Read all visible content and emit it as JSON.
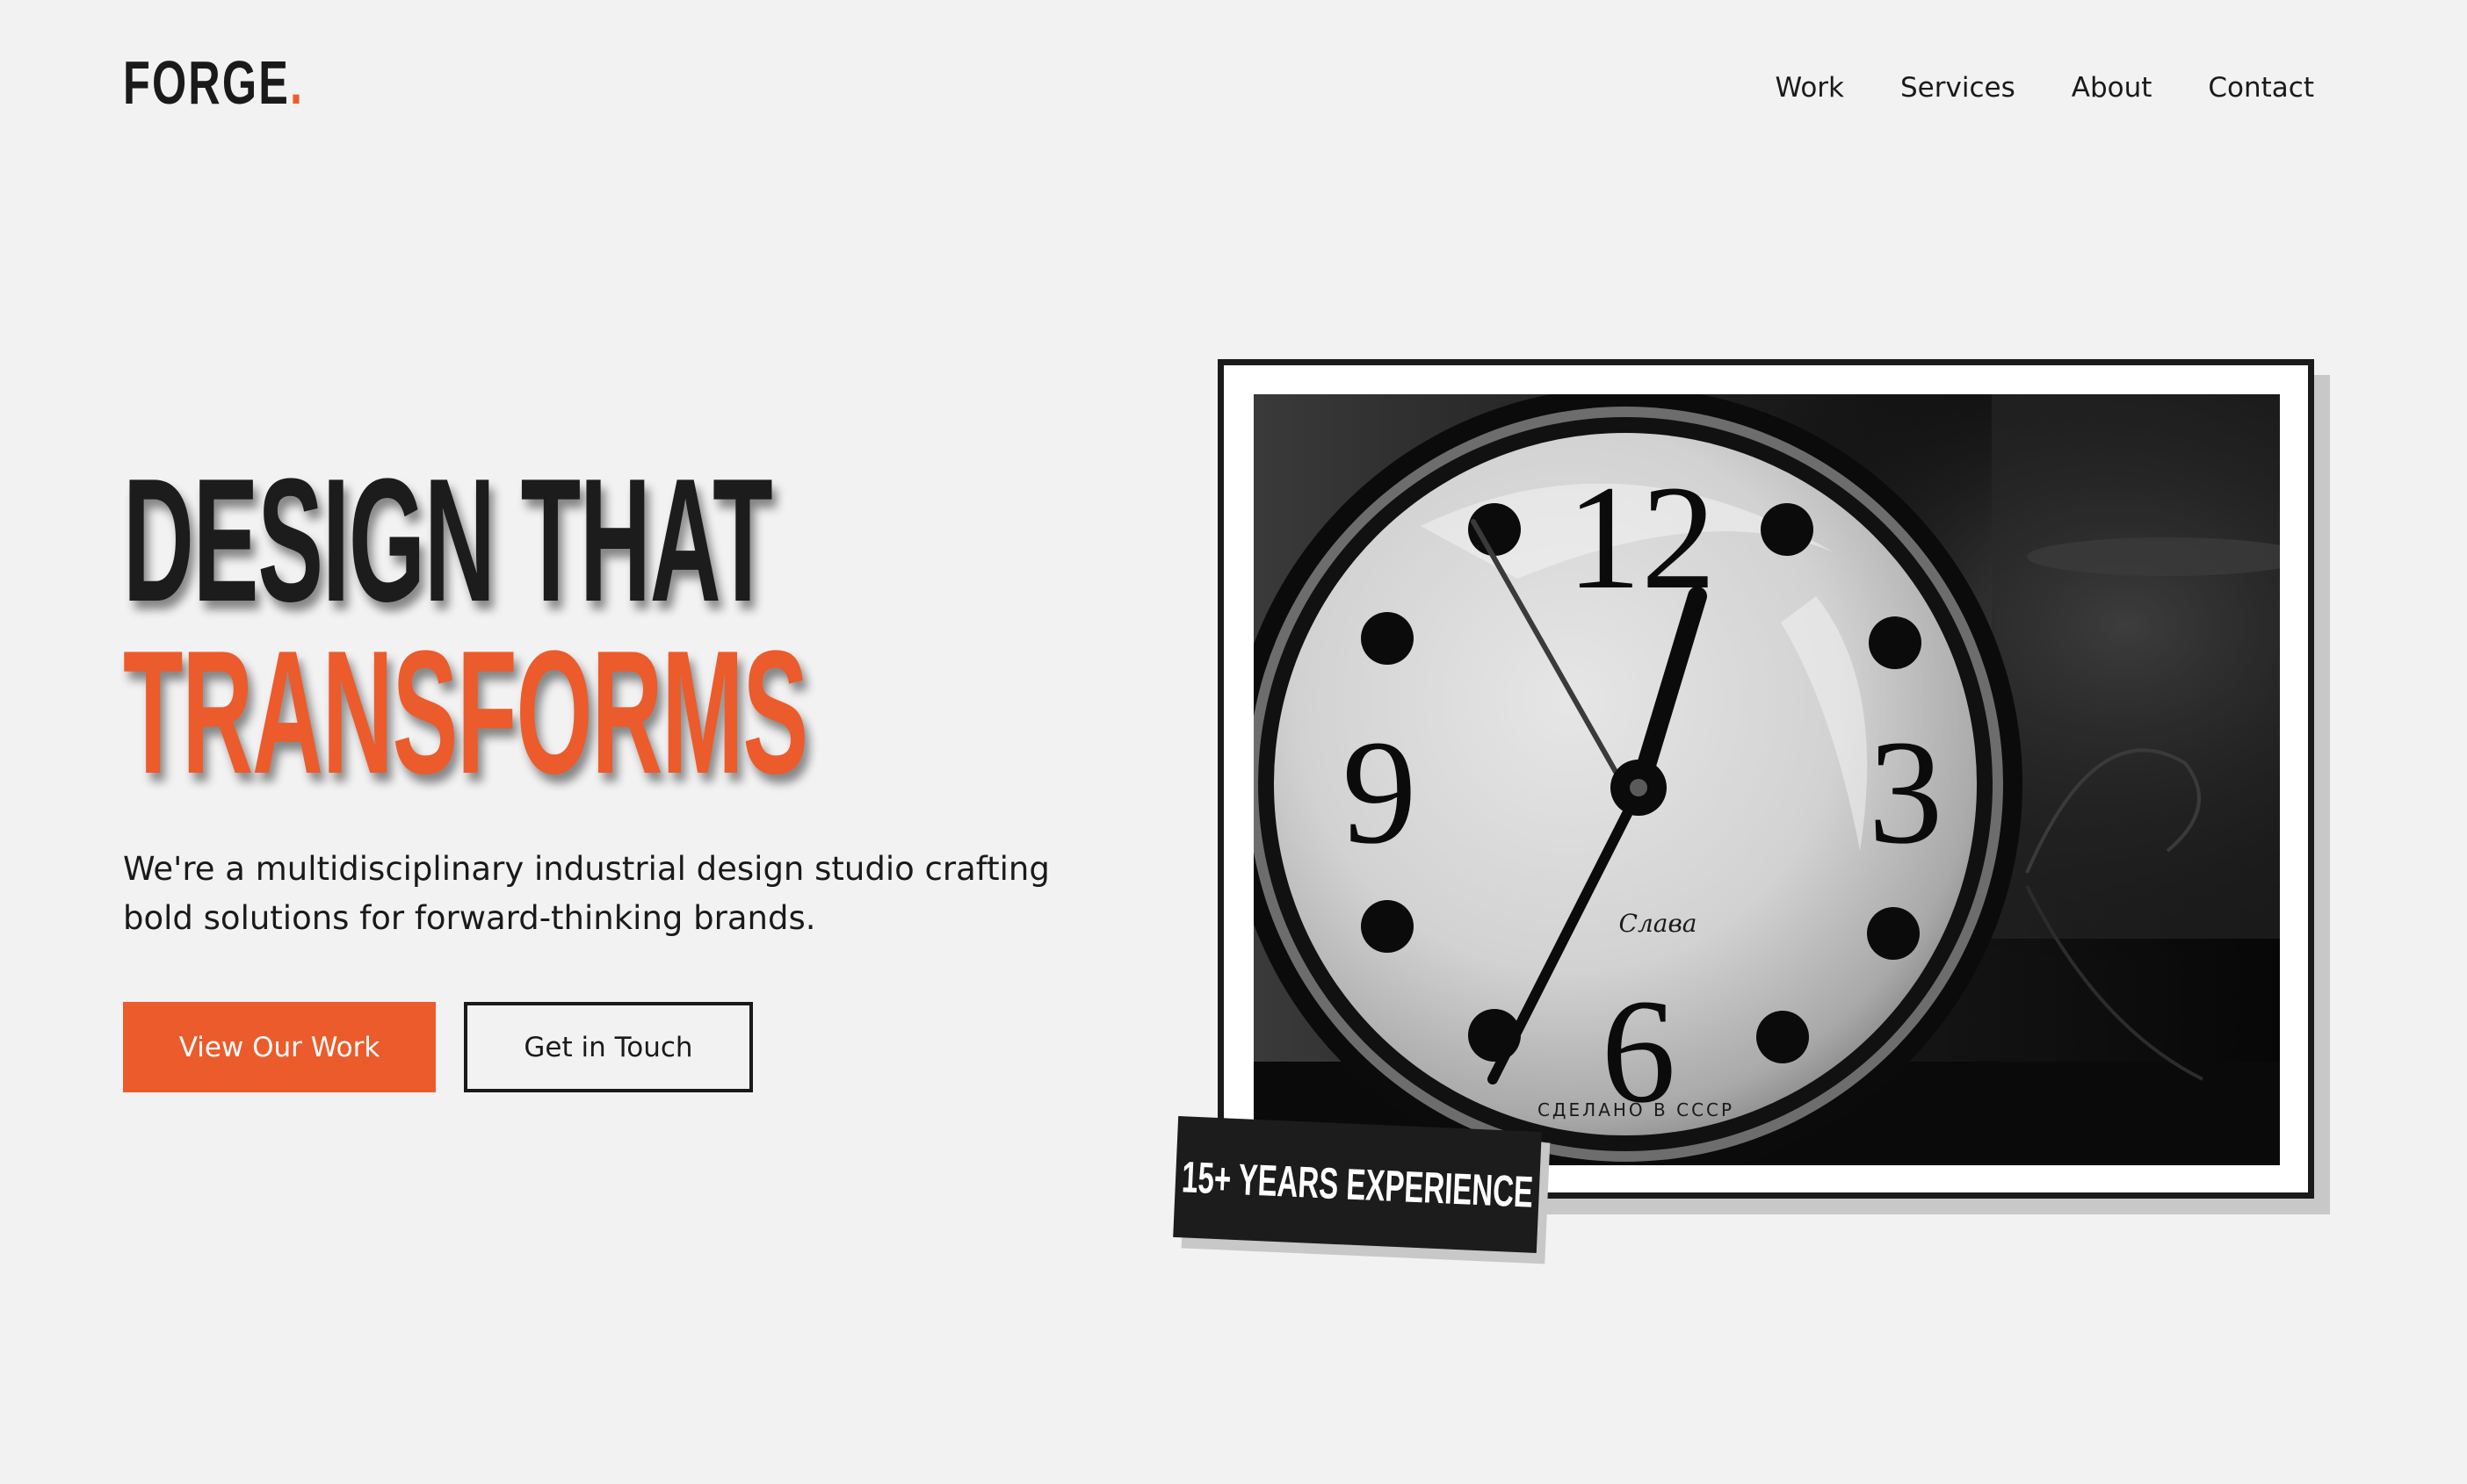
{
  "brand": {
    "name": "FORGE",
    "dot": ".",
    "accent_color": "#ec5b2b"
  },
  "nav": {
    "items": [
      {
        "label": "Work"
      },
      {
        "label": "Services"
      },
      {
        "label": "About"
      },
      {
        "label": "Contact"
      }
    ]
  },
  "hero": {
    "headline_line1": "DESIGN THAT",
    "headline_line2": "TRANSFORMS",
    "subtitle": "We're a multidisciplinary industrial design studio crafting bold solutions for forward-thinking brands.",
    "primary_button": "View Our Work",
    "secondary_button": "Get in Touch"
  },
  "image": {
    "subject": "vintage alarm clock, black and white",
    "dial_numerals": [
      "12",
      "3",
      "6",
      "9"
    ],
    "dial_brand": "Слава",
    "dial_footer": "СДЕЛАНО В СССР"
  },
  "badge": {
    "label": "15+ YEARS EXPERIENCE"
  }
}
